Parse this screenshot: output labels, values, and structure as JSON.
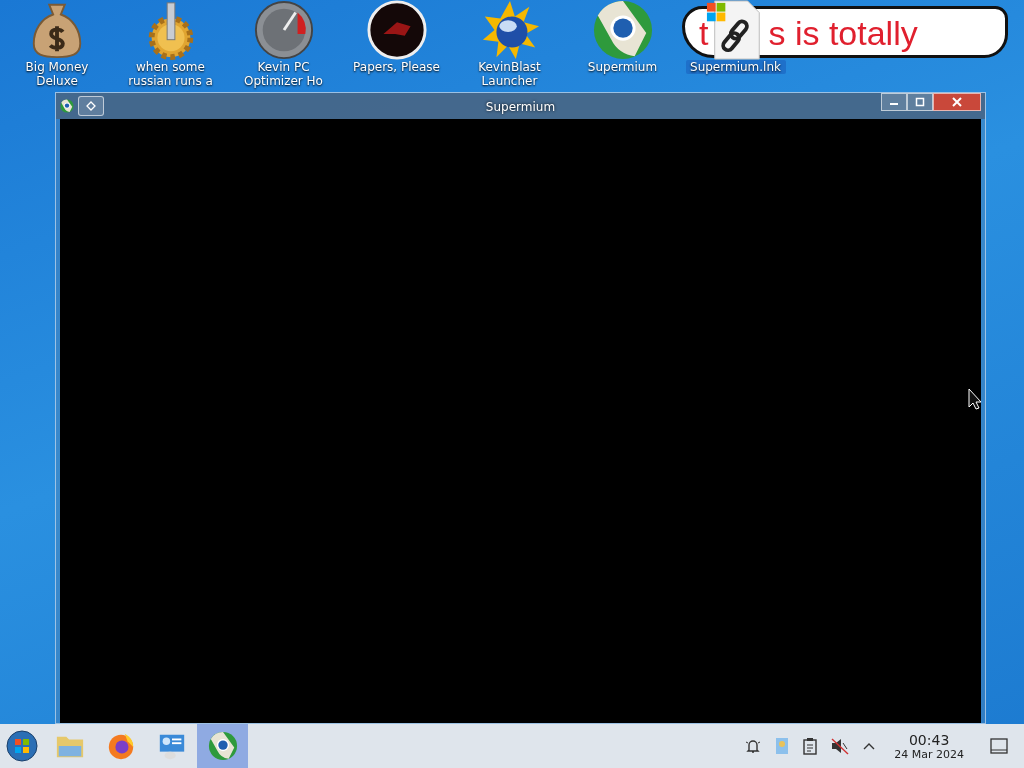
{
  "desktop_icons": [
    {
      "kind": "money-bag",
      "label": "Big Money Deluxe"
    },
    {
      "kind": "gear",
      "label": "when some russian runs a"
    },
    {
      "kind": "gauge",
      "label": "Kevin PC Optimizer Ho"
    },
    {
      "kind": "emblem",
      "label": "Papers, Please"
    },
    {
      "kind": "sun-globe",
      "label": "KevinBlast Launcher"
    },
    {
      "kind": "browser",
      "label": "Supermium"
    },
    {
      "kind": "shortcut",
      "label": "Supermium.lnk"
    }
  ],
  "sticker": {
    "lines": [
      "t",
      "s is totally"
    ]
  },
  "window": {
    "title": "Supermium"
  },
  "taskbar": {
    "buttons": [
      {
        "kind": "folder",
        "selected": false
      },
      {
        "kind": "fox-browser",
        "selected": false
      },
      {
        "kind": "remote-desktop",
        "selected": false
      },
      {
        "kind": "browser",
        "selected": true
      }
    ],
    "clock": {
      "time": "00:43",
      "date": "24 Mar 2024"
    }
  }
}
